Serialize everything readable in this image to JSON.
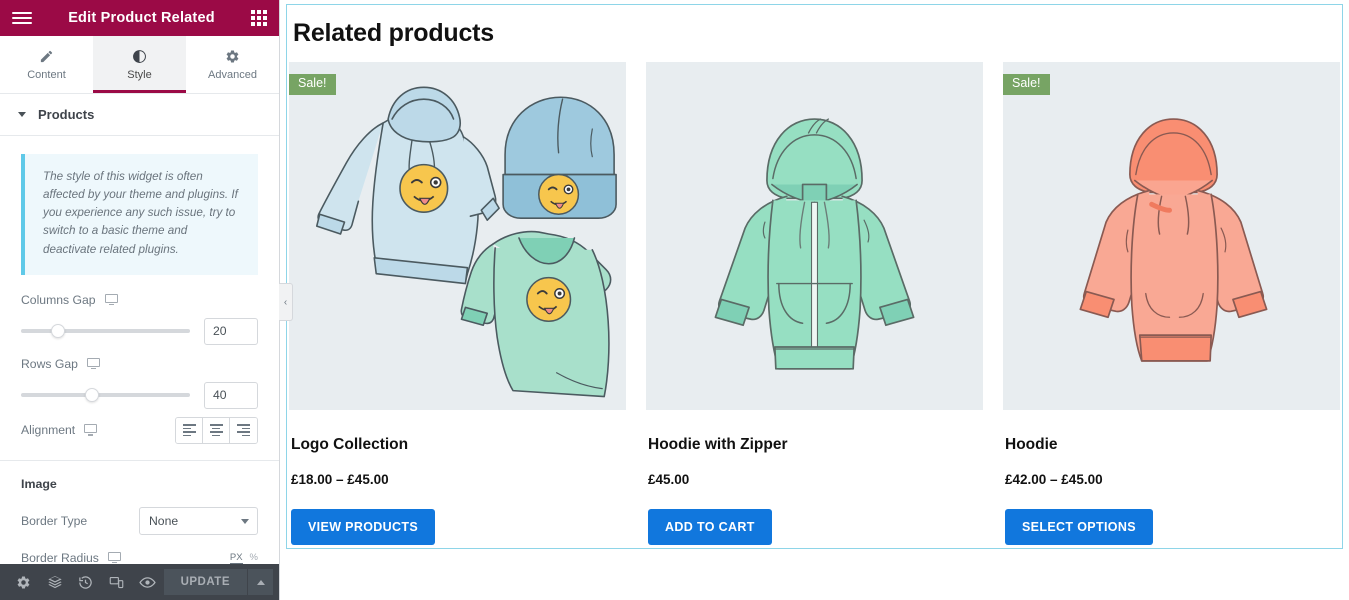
{
  "panel": {
    "title": "Edit Product Related",
    "menu_icon": "hamburger-icon",
    "apps_icon": "apps-grid-icon",
    "tabs": [
      {
        "label": "Content",
        "icon": "pencil-icon",
        "active": false
      },
      {
        "label": "Style",
        "icon": "contrast-circle-icon",
        "active": true
      },
      {
        "label": "Advanced",
        "icon": "gear-icon",
        "active": false
      }
    ],
    "section": {
      "title": "Products",
      "expanded": true
    },
    "notice": "The style of this widget is often affected by your theme and plugins. If you experience any such issue, try to switch to a basic theme and deactivate related plugins.",
    "controls": {
      "columns_gap": {
        "label": "Columns Gap",
        "value": "20",
        "device_icon": "monitor-icon",
        "knob_percent": 18
      },
      "rows_gap": {
        "label": "Rows Gap",
        "value": "40",
        "device_icon": "monitor-icon",
        "knob_percent": 38
      },
      "alignment": {
        "label": "Alignment",
        "device_icon": "monitor-icon",
        "options": [
          "align-left",
          "align-center",
          "align-right"
        ]
      }
    },
    "image_section": {
      "title": "Image",
      "border_type": {
        "label": "Border Type",
        "value": "None"
      },
      "border_radius": {
        "label": "Border Radius",
        "device_icon": "monitor-icon",
        "units": [
          "PX",
          "%"
        ],
        "active_unit": "PX"
      }
    },
    "footer": {
      "icons": [
        "gear-icon",
        "layers-icon",
        "history-icon",
        "responsive-icon",
        "eye-icon"
      ],
      "update_label": "UPDATE",
      "caret_icon": "chevron-up-icon"
    },
    "collapse_handle": "‹"
  },
  "canvas": {
    "heading": "Related products",
    "colors": {
      "accent_blue": "#1177dd",
      "sale_green": "#77a464",
      "thumb_bg": "#e8edf0",
      "widget_border": "#8ed5e8",
      "header_maroon": "#9b0a46"
    },
    "products": [
      {
        "name": "Logo Collection",
        "price": "£18.00 – £45.00",
        "button": "VIEW PRODUCTS",
        "badge": "Sale!",
        "on_sale": true,
        "art": "logo-collection-apparel"
      },
      {
        "name": "Hoodie with Zipper",
        "price": "£45.00",
        "button": "ADD TO CART",
        "badge": "",
        "on_sale": false,
        "art": "mint-zip-hoodie"
      },
      {
        "name": "Hoodie",
        "price": "£42.00 – £45.00",
        "button": "SELECT OPTIONS",
        "badge": "Sale!",
        "on_sale": true,
        "art": "salmon-hoodie"
      }
    ]
  }
}
